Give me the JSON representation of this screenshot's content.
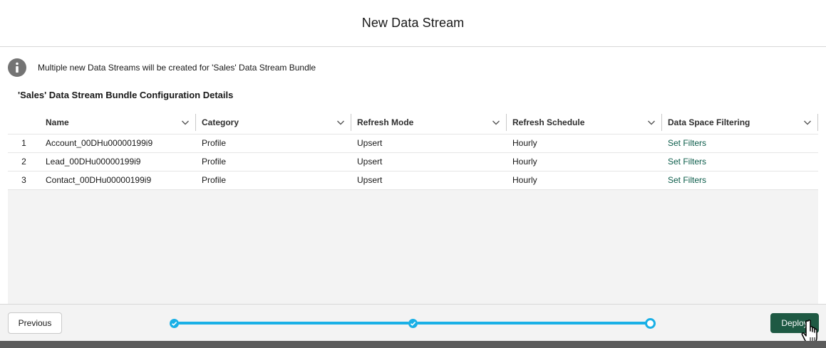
{
  "modal": {
    "title": "New Data Stream"
  },
  "info": {
    "icon": "info-icon",
    "message": "Multiple new Data Streams will be created for 'Sales' Data Stream Bundle"
  },
  "section": {
    "title": "'Sales' Data Stream Bundle Configuration Details"
  },
  "table": {
    "columns": [
      "Name",
      "Category",
      "Refresh Mode",
      "Refresh Schedule",
      "Data Space Filtering"
    ],
    "rows": [
      {
        "num": "1",
        "name": "Account_00DHu00000199i9",
        "category": "Profile",
        "refresh_mode": "Upsert",
        "refresh_schedule": "Hourly",
        "filtering": "Set Filters"
      },
      {
        "num": "2",
        "name": "Lead_00DHu00000199i9",
        "category": "Profile",
        "refresh_mode": "Upsert",
        "refresh_schedule": "Hourly",
        "filtering": "Set Filters"
      },
      {
        "num": "3",
        "name": "Contact_00DHu00000199i9",
        "category": "Profile",
        "refresh_mode": "Upsert",
        "refresh_schedule": "Hourly",
        "filtering": "Set Filters"
      }
    ]
  },
  "footer": {
    "previous_label": "Previous",
    "deploy_label": "Deploy"
  },
  "progress": {
    "steps_total": 3,
    "steps_completed": 2,
    "current_step": 3
  },
  "colors": {
    "accent": "#1ab0e6",
    "brand_button": "#1e5943",
    "link": "#0b5c4a",
    "info_icon": "#747474"
  }
}
